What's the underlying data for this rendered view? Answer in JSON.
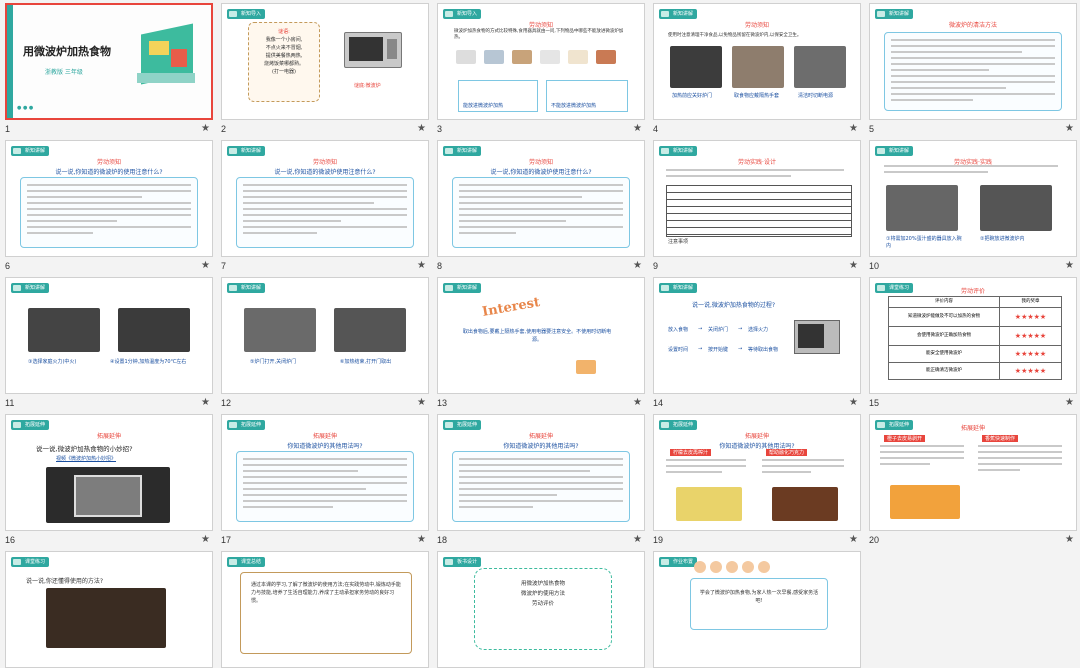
{
  "slides": [
    {
      "n": "1",
      "title": "用微波炉加热食物",
      "sub": "浙教版  三年级",
      "dots": "● ● ●"
    },
    {
      "n": "2",
      "tag": "新知导入",
      "riddle": [
        "谜语:",
        "我像一个小房间,",
        "不点火来不冒烟,",
        "提供美餐热两热,",
        "烧烤饭菜哪都熟。",
        "(打一电器)"
      ],
      "answer": "谜底:微波炉"
    },
    {
      "n": "3",
      "tag": "新知导入",
      "hdr": "劳动须知",
      "intro": "微波炉加热食物的方式比较特殊,食用器具就由一问,下列物品中哪些不能放进微波炉加热。",
      "left": "能放进微波炉加热",
      "right": "不能放进微波炉加热"
    },
    {
      "n": "4",
      "tag": "新知讲解",
      "hdr": "劳动须知",
      "intro": "使用时注意清理干净食品,以免物品残留在微波炉内,以保安全卫生。",
      "caps": [
        "加热前应关好炉门",
        "取食物应戴隔热手套",
        "清洁时切断电源"
      ]
    },
    {
      "n": "5",
      "tag": "新知讲解",
      "hdr": "微波炉的清洁方法"
    },
    {
      "n": "6",
      "tag": "新知讲解",
      "hdr": "劳动须知",
      "q": "说一说,你知道的微波炉的使用注意什么?"
    },
    {
      "n": "7",
      "tag": "新知讲解",
      "hdr": "劳动须知",
      "q": "说一说,你知道的微波炉使用注意什么?"
    },
    {
      "n": "8",
      "tag": "新知讲解",
      "hdr": "劳动须知",
      "q": "说一说,你知道的微波炉使用注意什么?"
    },
    {
      "n": "9",
      "tag": "新知讲解",
      "hdr": "劳动实践·设计",
      "note": "注意事项"
    },
    {
      "n": "10",
      "tag": "新知讲解",
      "hdr": "劳动实践·实践",
      "caps": [
        "①将需加20%蛋汁盛的器具放入碗内",
        "②把碗放进微波炉内"
      ]
    },
    {
      "n": "11",
      "tag": "新知讲解",
      "caps": [
        "③选择家庭火力(中火)",
        "④设置1分钟,加热温度为70℃左右"
      ]
    },
    {
      "n": "12",
      "tag": "新知讲解",
      "caps": [
        "⑤炉门打开,关闭炉门",
        "⑥加热结束,打开门取出"
      ]
    },
    {
      "n": "13",
      "tag": "新知讲解",
      "logo": "Interest",
      "text": "取出食物后,要戴上隔热手套,使用电器要注意安全。不使用时切断电源。"
    },
    {
      "n": "14",
      "tag": "新知讲解",
      "q": "说一说,微波炉加热食物的过程?",
      "flow": [
        "放入食物",
        "关闭炉门",
        "选择火力",
        "设置时间",
        "按开始键",
        "等待取出食物"
      ]
    },
    {
      "n": "15",
      "tag": "课堂练习",
      "hdr": "劳动评价",
      "cols": [
        "评价内容",
        "我的奖章"
      ],
      "rows": [
        "知道微波炉能做及不可以加热的食物",
        "会使用微波炉正确加热食物",
        "能安全使用微波炉",
        "能正确清洁微波炉"
      ],
      "stars": "★★★★★"
    },
    {
      "n": "16",
      "tag": "拓展延伸",
      "hdr": "拓展延伸",
      "q": "说一说,微波炉加热食物的小妙招?",
      "link": "视频《微波炉加热小妙招》"
    },
    {
      "n": "17",
      "tag": "拓展延伸",
      "hdr": "拓展延伸",
      "q": "你知道微波炉的其他用法吗?"
    },
    {
      "n": "18",
      "tag": "拓展延伸",
      "hdr": "拓展延伸",
      "q": "你知道微波炉的其他用法吗?"
    },
    {
      "n": "19",
      "tag": "拓展延伸",
      "hdr": "拓展延伸",
      "q": "你知道微波炉的其他用法吗?",
      "caps": [
        "柠檬去皮再榨汁",
        "帮助融化巧克力"
      ]
    },
    {
      "n": "20",
      "tag": "拓展延伸",
      "hdr": "拓展延伸",
      "caps": [
        "橙子去皮易剥开",
        "香蕉快速制作"
      ]
    },
    {
      "n": "",
      "tag": "课堂练习",
      "q": "说一说,你还懂得使用的方法?"
    },
    {
      "n": "",
      "tag": "课堂总结",
      "text": "通过本课的学习,了解了微波炉的使用方法;在实践劳动中,锻炼动手能力与技能,培养了生活自理能力,养成了主动承担家务劳动的良好习惯。"
    },
    {
      "n": "",
      "tag": "板书设计",
      "lines": [
        "用微波炉加热食物",
        "微波炉的使用方法",
        "劳动评价"
      ]
    },
    {
      "n": "",
      "tag": "作业布置",
      "text": "学会了微波炉加热食物,为家人热一次早餐,感受家务活吧!"
    }
  ]
}
